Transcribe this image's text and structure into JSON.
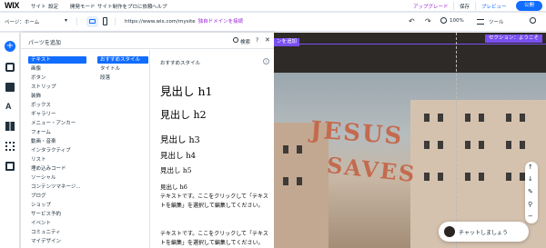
{
  "topbar": {
    "logo": "WIX",
    "menus": [
      "サイト",
      "設定",
      "開発モード",
      "サイト制作をプロに依頼",
      "ヘルプ"
    ],
    "upgrade": "アップグレード",
    "save": "保存",
    "preview": "プレビュー",
    "publish": "公開"
  },
  "toolbar": {
    "page_selector": "ページ：ホーム",
    "url": "https://www.wix.com/mysite",
    "connect_domain": "独自ドメインを接続",
    "zoom": "100%",
    "tools": "ツール"
  },
  "panel": {
    "title": "パーツを追加",
    "search": "検索",
    "help": "?",
    "close": "✕",
    "categories": [
      "テキスト",
      "画像",
      "ボタン",
      "ストリップ",
      "装飾",
      "ボックス",
      "ギャラリー",
      "メニュー・アンカー",
      "フォーム",
      "動画・音楽",
      "インタラクティブ",
      "リスト",
      "埋め込みコード",
      "ソーシャル",
      "コンテンツマネージ...",
      "ブログ",
      "ショップ",
      "サービス予約",
      "イベント",
      "コミュニティ",
      "マイデザイン"
    ],
    "subcategories": [
      "おすすめスタイル",
      "タイトル",
      "段落"
    ],
    "content_title": "おすすめスタイル",
    "headings": [
      "見出し h1",
      "見出し h2",
      "見出し h3",
      "見出し h4",
      "見出し h5",
      "見出し h6"
    ],
    "paragraphs": [
      "テキストです。ここをクリックして「テキストを編集」を選択して編集してください。",
      "テキストです。ここをクリックして「テキストを編集」を選択して編集してください。"
    ]
  },
  "canvas": {
    "section_tag": "セクション：ようこそ",
    "section_tag_left": "ンを追加",
    "sign_line1": "JESUS",
    "sign_line2": "SAVES",
    "chat_label": "チャットしましょう"
  },
  "colors": {
    "accent": "#116dff",
    "section": "#7a4ff0",
    "upgrade": "#9a27d5"
  }
}
